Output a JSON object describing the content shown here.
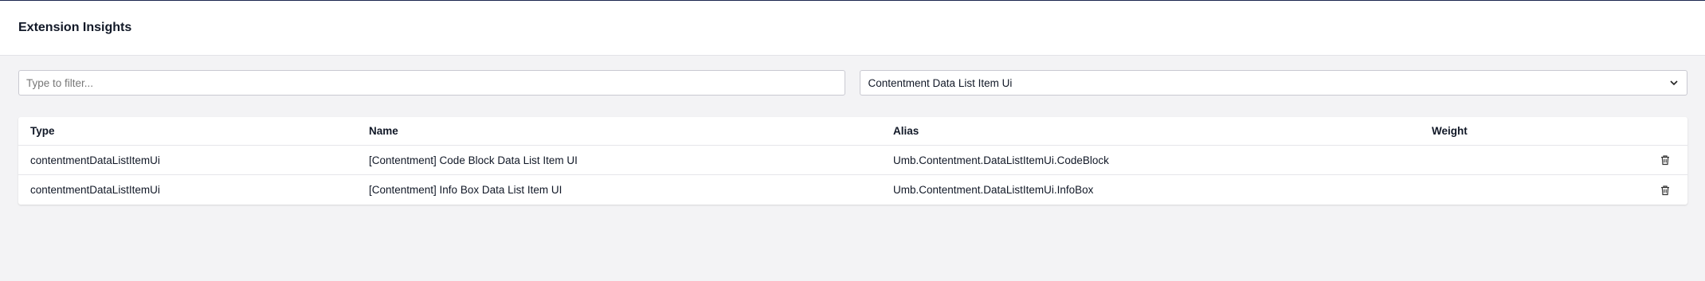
{
  "header": {
    "title": "Extension Insights"
  },
  "filter": {
    "placeholder": "Type to filter...",
    "value": ""
  },
  "type_select": {
    "selected": "Contentment Data List Item Ui"
  },
  "table": {
    "columns": {
      "type": "Type",
      "name": "Name",
      "alias": "Alias",
      "weight": "Weight"
    },
    "rows": [
      {
        "type": "contentmentDataListItemUi",
        "name": "[Contentment] Code Block Data List Item UI",
        "alias": "Umb.Contentment.DataListItemUi.CodeBlock",
        "weight": ""
      },
      {
        "type": "contentmentDataListItemUi",
        "name": "[Contentment] Info Box Data List Item UI",
        "alias": "Umb.Contentment.DataListItemUi.InfoBox",
        "weight": ""
      }
    ]
  },
  "icons": {
    "delete": "trash-icon",
    "dropdown": "chevron-down-icon"
  }
}
